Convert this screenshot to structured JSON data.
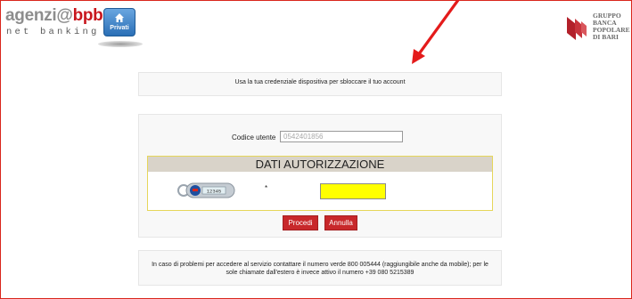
{
  "header": {
    "logo_main": "agenzi@",
    "logo_brand": "bpb",
    "logo_sub": "net banking",
    "privati_label": "Privati",
    "bank_lines": [
      "GRUPPO",
      "BANCA",
      "POPOLARE",
      "DI BARI"
    ]
  },
  "message": "Usa la tua credenziale dispositiva per sbloccare il tuo account",
  "form": {
    "user_code_label": "Codice utente",
    "user_code_value": "0542401856",
    "panel_title": "DATI AUTORIZZAZIONE",
    "token_display": "12345",
    "required_marker": "*",
    "otp_value": ""
  },
  "buttons": {
    "proceed": "Procedi",
    "cancel": "Annulla"
  },
  "info": "In caso di problemi per accedere al servizio contattare il numero verde 800 005444 (raggiungibile anche da mobile); per le sole chiamate dall'estero è invece attivo il numero +39 080 5215389",
  "colors": {
    "brand_red": "#c8161d",
    "button_red": "#c8282b",
    "otp_yellow": "#ffff00",
    "arrow_red": "#e41b1b"
  },
  "icons": {
    "privati": "house-icon",
    "bank": "bpb-flag-logo",
    "token": "otp-token-device",
    "annotation": "red-arrow"
  }
}
